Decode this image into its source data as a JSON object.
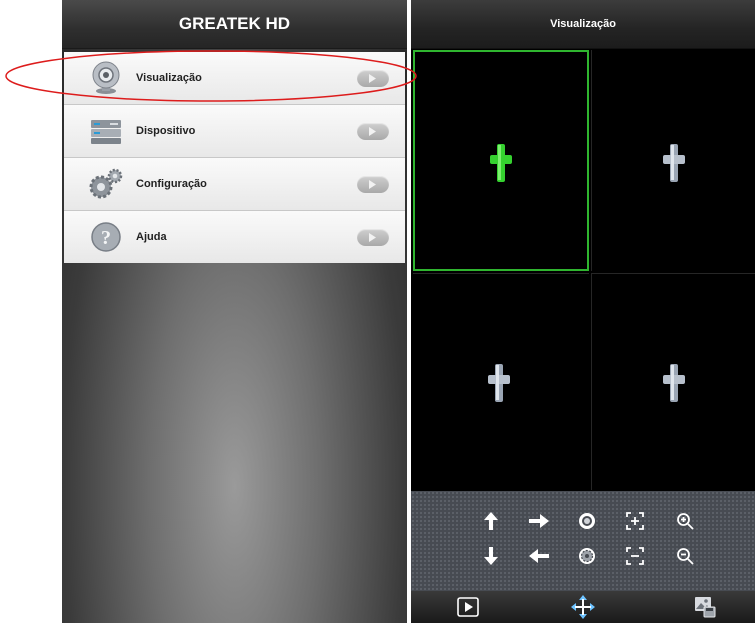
{
  "left_screen": {
    "title": "GREATEK HD",
    "menu": [
      {
        "label": "Visualização",
        "icon": "webcam-icon"
      },
      {
        "label": "Dispositivo",
        "icon": "device-icon"
      },
      {
        "label": "Configuração",
        "icon": "gears-icon"
      },
      {
        "label": "Ajuda",
        "icon": "help-icon"
      }
    ]
  },
  "right_screen": {
    "title": "Visualização",
    "selected_cell": 1,
    "accent_color": "#2fb52f",
    "ptz_controls": [
      "arrow-up-icon",
      "arrow-right-icon",
      "focus-near-icon",
      "zoom-frame-in-icon",
      "zoom-in-icon",
      "arrow-down-icon",
      "arrow-left-icon",
      "focus-far-icon",
      "zoom-frame-out-icon",
      "zoom-out-icon"
    ],
    "bottom_bar": [
      "play-icon",
      "ptz-move-icon",
      "snapshot-icon"
    ]
  }
}
